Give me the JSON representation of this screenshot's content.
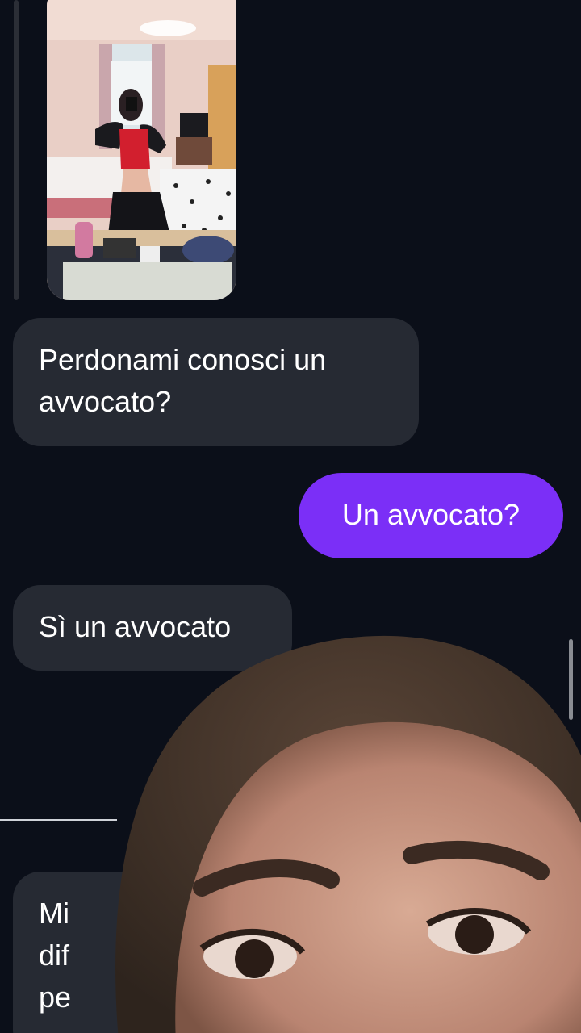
{
  "messages": [
    {
      "from": "them",
      "type": "photo",
      "alt_icon": "photo-attachment"
    },
    {
      "from": "them",
      "type": "text",
      "text": "Perdonami conosci un avvocato?"
    },
    {
      "from": "me",
      "type": "text",
      "text": "Un avvocato?"
    },
    {
      "from": "them",
      "type": "text",
      "text": "Sì un avvocato"
    },
    {
      "from": "them",
      "type": "text",
      "lines": [
        "Mi",
        "dif",
        "pe"
      ]
    }
  ],
  "colors": {
    "background": "#0b0f19",
    "incoming_bubble": "#262a33",
    "outgoing_bubble": "#7b2ff7",
    "text": "#ffffff"
  }
}
